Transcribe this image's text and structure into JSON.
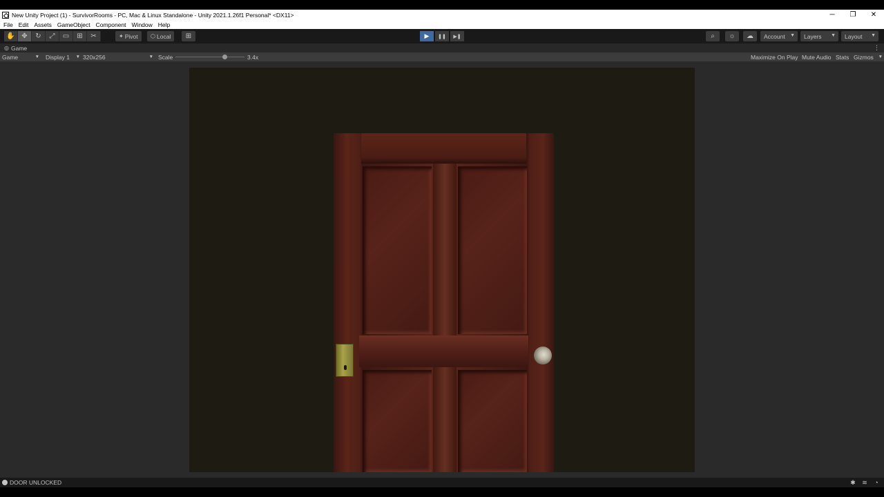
{
  "window": {
    "title": "New Unity Project (1) - SurvivorRooms - PC, Mac & Linux Standalone - Unity 2021.1.26f1 Personal* <DX11>",
    "controls": {
      "minimize": "─",
      "restore": "❐",
      "close": "✕"
    }
  },
  "menu": [
    "File",
    "Edit",
    "Assets",
    "GameObject",
    "Component",
    "Window",
    "Help"
  ],
  "toolbar": {
    "tools": [
      {
        "name": "hand-tool",
        "glyph": "✋"
      },
      {
        "name": "move-tool",
        "glyph": "✥"
      },
      {
        "name": "rotate-tool",
        "glyph": "↻"
      },
      {
        "name": "scale-tool",
        "glyph": "⤢"
      },
      {
        "name": "rect-tool",
        "glyph": "▭"
      },
      {
        "name": "transform-tool",
        "glyph": "⊞"
      },
      {
        "name": "custom-tool",
        "glyph": "✂"
      }
    ],
    "pivot_label": "Pivot",
    "local_label": "Local",
    "grid_glyph": "⊞",
    "play": {
      "play_glyph": "▶",
      "pause_glyph": "❚❚",
      "step_glyph": "▶❚",
      "state": "playing"
    },
    "search_glyph": "⌕",
    "collab_glyph": "☼",
    "cloud_glyph": "☁",
    "account_label": "Account",
    "layers_label": "Layers",
    "layout_label": "Layout"
  },
  "game_tab": {
    "label": "Game",
    "icon": "gamepad-icon",
    "glyph": "👾",
    "menu_glyph": "⋮"
  },
  "game_bar": {
    "mode": "Game",
    "display": "Display 1",
    "resolution": "320x256",
    "scale_label": "Scale",
    "scale_value": "3.4x",
    "scale_fraction": 0.71,
    "maximize_on_play": "Maximize On Play",
    "mute_audio": "Mute Audio",
    "stats": "Stats",
    "gizmos": "Gizmos",
    "caret": "▼"
  },
  "status": {
    "message": "DOOR UNLOCKED",
    "icons": [
      "debug-icon",
      "layers-stack-icon",
      "progress-icon"
    ],
    "glyphs": [
      "✱",
      "≋",
      "◔"
    ]
  },
  "colors": {
    "play_active": "#3d6aa2",
    "editor_dark": "#191919",
    "game_background": "#1e1b13",
    "door_wood": "#5a261b"
  }
}
